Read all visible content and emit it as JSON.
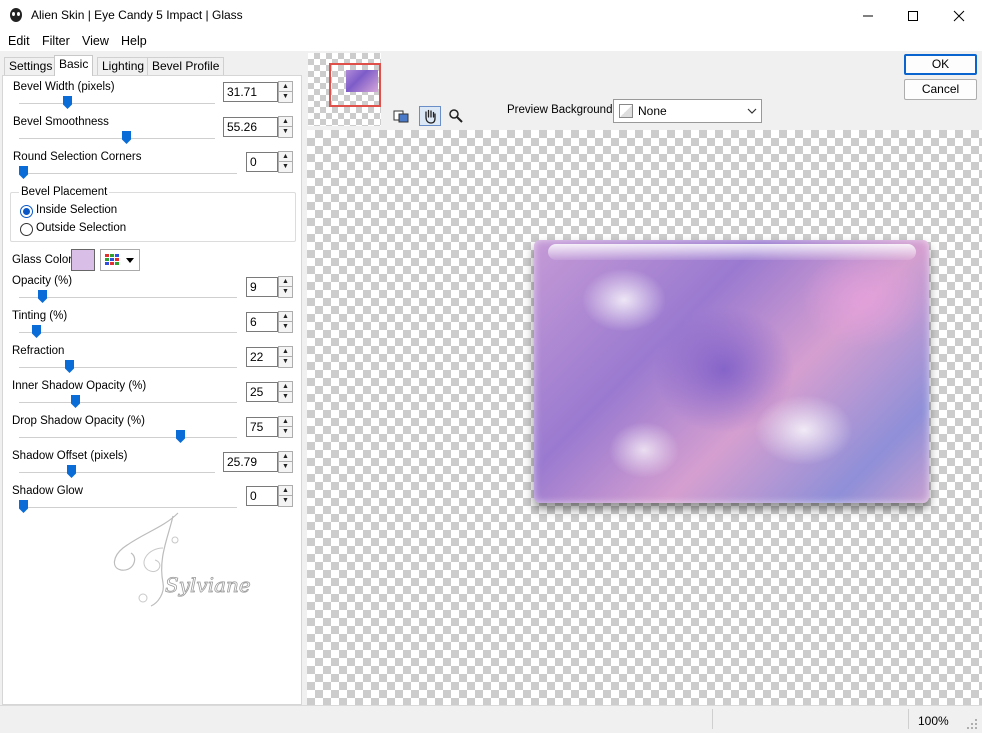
{
  "window": {
    "title": "Alien Skin | Eye Candy 5 Impact | Glass"
  },
  "menu": [
    {
      "label": "Edit"
    },
    {
      "label": "Filter"
    },
    {
      "label": "View"
    },
    {
      "label": "Help"
    }
  ],
  "tabs": [
    {
      "label": "Settings"
    },
    {
      "label": "Basic"
    },
    {
      "label": "Lighting"
    },
    {
      "label": "Bevel Profile"
    }
  ],
  "basic": {
    "bevel_width": {
      "label": "Bevel Width (pixels)",
      "value": "31.71",
      "slider_fraction": 0.33
    },
    "bevel_smoothness": {
      "label": "Bevel Smoothness",
      "value": "55.26",
      "slider_fraction": 0.55
    },
    "round_corners": {
      "label": "Round Selection Corners",
      "value": "0",
      "slider_fraction": 0.0
    },
    "bevel_placement": {
      "label": "Bevel Placement",
      "options": [
        {
          "label": "Inside Selection",
          "selected": true
        },
        {
          "label": "Outside Selection",
          "selected": false
        }
      ]
    },
    "glass_color": {
      "label": "Glass Color",
      "color": "#d9bfe8"
    },
    "opacity": {
      "label": "Opacity (%)",
      "value": "9",
      "slider_fraction": 0.09
    },
    "tinting": {
      "label": "Tinting (%)",
      "value": "6",
      "slider_fraction": 0.06
    },
    "refraction": {
      "label": "Refraction",
      "value": "22",
      "slider_fraction": 0.22
    },
    "inner_shadow_opacity": {
      "label": "Inner Shadow Opacity (%)",
      "value": "25",
      "slider_fraction": 0.25
    },
    "drop_shadow_opacity": {
      "label": "Drop Shadow Opacity (%)",
      "value": "75",
      "slider_fraction": 0.75
    },
    "shadow_offset": {
      "label": "Shadow Offset (pixels)",
      "value": "25.79",
      "slider_fraction": 0.26
    },
    "shadow_glow": {
      "label": "Shadow Glow",
      "value": "0",
      "slider_fraction": 0.0
    }
  },
  "watermark_text": "Sylviane",
  "buttons": {
    "ok": "OK",
    "cancel": "Cancel"
  },
  "preview_background": {
    "label": "Preview Background:",
    "value": "None"
  },
  "status": {
    "zoom": "100%"
  },
  "colors": {
    "accent": "#0a6cd6",
    "nav_box": "#e0504a"
  }
}
